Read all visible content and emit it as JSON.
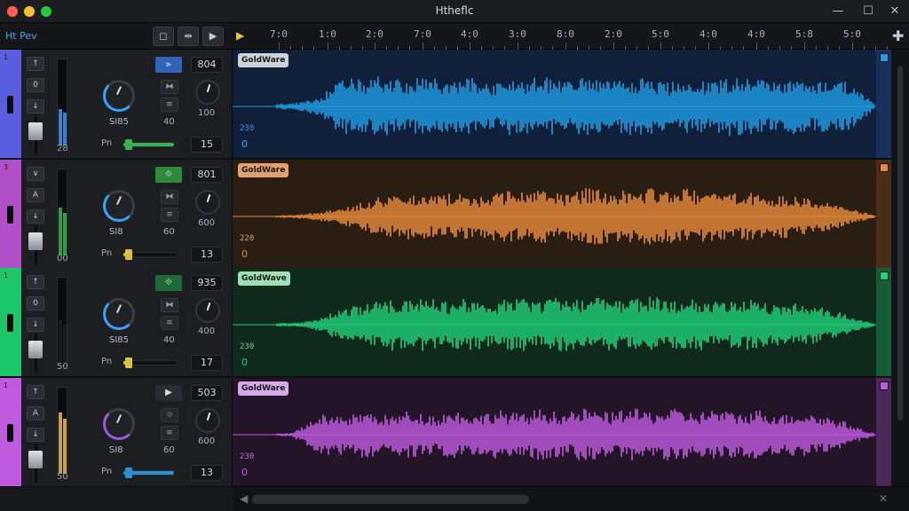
{
  "window": {
    "title": "Htheflc",
    "controls": {
      "minimize": "—",
      "maximize": "☐",
      "close": "✕"
    }
  },
  "toolbar": {
    "project_label": "Ht Pev",
    "buttons": [
      {
        "name": "loop-button",
        "glyph": "◻"
      },
      {
        "name": "snap-button",
        "glyph": "⇹"
      },
      {
        "name": "play-button",
        "glyph": "▶"
      }
    ],
    "add_track": "✚"
  },
  "ruler": {
    "labels": [
      "7:0",
      "1:0",
      "2:0",
      "7:0",
      "4:0",
      "3:0",
      "8:0",
      "2:0",
      "5:0",
      "4:0",
      "4:0",
      "5:8",
      "5:0"
    ]
  },
  "tracks": [
    {
      "color": "#1e9ee6",
      "strip_color": "#5a5fe0",
      "label_color": "#cfd2d8",
      "strip_num": "1",
      "side_buttons": [
        "↑",
        "0",
        "↓"
      ],
      "mode_glyph": "⫸",
      "mode_bg": "#2f64b8",
      "knob_label": "SI85",
      "knob_arc": "#3aa0ff",
      "icon_buttons": [
        "⧓",
        "≡"
      ],
      "icon_value": "40",
      "value": "804",
      "small_knob_value": "100",
      "meter_value": "28",
      "meter_level": 0.42,
      "meter_color": "#3a7fd0",
      "pan_label": "Pn",
      "pan_value": "15",
      "pan_level": 0.95,
      "pan_color": "#37b24d",
      "clip_label": "GoldWare",
      "lane_num_a": "230",
      "lane_num_b": "0",
      "lane_bg": "#11203a",
      "lane_a_color": "#3a93e0",
      "lane_b_color": "#3aa0ff",
      "endcap_bg": "#17315a",
      "envelope": [
        0.08,
        0.1,
        0.16,
        0.3,
        0.7,
        0.85,
        0.78,
        0.92,
        0.84,
        0.74,
        0.9,
        0.82,
        0.72,
        0.88,
        0.8,
        0.7,
        0.86,
        0.78,
        0.92,
        0.84,
        0.76,
        0.9,
        0.82,
        0.72,
        0.88,
        0.86,
        0.8,
        0.7,
        0.86,
        0.8,
        0.74,
        0.88,
        0.9,
        0.84,
        0.74,
        0.86,
        0.8,
        0.72,
        0.84,
        0.78,
        0.5,
        0.1
      ]
    },
    {
      "color": "#e88a3a",
      "strip_color": "#b04fc6",
      "label_color": "#e0a070",
      "strip_num": "3",
      "side_buttons": [
        "∨",
        "A",
        "↓"
      ],
      "mode_glyph": "⟐",
      "mode_bg": "#2d8a3a",
      "knob_label": "SI8",
      "knob_arc": "#3aa0ff",
      "icon_buttons": [
        "⧓",
        "≡"
      ],
      "icon_value": "60",
      "value": "801",
      "small_knob_value": "600",
      "meter_value": "00",
      "meter_level": 0.55,
      "meter_color": "#2ea043",
      "pan_label": "Pn",
      "pan_value": "13",
      "pan_level": 0.12,
      "pan_color": "#d9c13a",
      "clip_label": "GoldWare",
      "lane_num_a": "220",
      "lane_num_b": "0",
      "lane_bg": "#2a1d12",
      "lane_a_color": "#e0a070",
      "lane_b_color": "#e88a3a",
      "endcap_bg": "#4a2e18",
      "envelope": [
        0.04,
        0.05,
        0.08,
        0.14,
        0.22,
        0.3,
        0.44,
        0.58,
        0.62,
        0.7,
        0.66,
        0.6,
        0.72,
        0.68,
        0.62,
        0.74,
        0.76,
        0.72,
        0.8,
        0.76,
        0.7,
        0.84,
        0.86,
        0.8,
        0.78,
        0.86,
        0.88,
        0.82,
        0.84,
        0.76,
        0.8,
        0.72,
        0.74,
        0.7,
        0.64,
        0.66,
        0.56,
        0.5,
        0.42,
        0.3,
        0.16,
        0.06
      ]
    },
    {
      "color": "#1fd17a",
      "strip_color": "#1ec86a",
      "label_color": "#9ee0b4",
      "strip_num": "1",
      "side_buttons": [
        "↑",
        "0",
        "↓"
      ],
      "mode_glyph": "⟐",
      "mode_bg": "#1f6a36",
      "knob_label": "SI85",
      "knob_arc": "#3aa0ff",
      "icon_buttons": [
        "⧓",
        "≡"
      ],
      "icon_value": "40",
      "value": "935",
      "small_knob_value": "400",
      "meter_value": "50",
      "meter_level": 0.5,
      "meter_color": "#1a1b1e",
      "pan_label": "Pn",
      "pan_value": "17",
      "pan_level": 0.14,
      "pan_color": "#d9c13a",
      "clip_label": "GoldWave",
      "lane_num_a": "230",
      "lane_num_b": "0",
      "lane_bg": "#0f2a1c",
      "lane_a_color": "#6bd79b",
      "lane_b_color": "#1fd17a",
      "endcap_bg": "#165c36",
      "envelope": [
        0.05,
        0.06,
        0.1,
        0.22,
        0.4,
        0.56,
        0.62,
        0.72,
        0.78,
        0.7,
        0.82,
        0.74,
        0.68,
        0.8,
        0.76,
        0.66,
        0.84,
        0.78,
        0.7,
        0.86,
        0.8,
        0.72,
        0.82,
        0.76,
        0.7,
        0.8,
        0.84,
        0.78,
        0.72,
        0.8,
        0.74,
        0.68,
        0.76,
        0.72,
        0.66,
        0.7,
        0.62,
        0.56,
        0.46,
        0.32,
        0.16,
        0.06
      ]
    },
    {
      "color": "#c05be0",
      "strip_color": "#c05be0",
      "label_color": "#d6a9ea",
      "strip_num": "1",
      "side_buttons": [
        "↑",
        "A",
        "↓"
      ],
      "mode_glyph": "▶",
      "mode_bg": "#2b2d32",
      "knob_label": "SI8",
      "knob_arc": "#9b59e0",
      "icon_buttons": [
        "⟐",
        "≡"
      ],
      "icon_value": "60",
      "value": "503",
      "small_knob_value": "600",
      "meter_value": "50",
      "meter_level": 0.7,
      "meter_color": "#c8a23a",
      "pan_label": "Pn",
      "pan_value": "13",
      "pan_level": 0.95,
      "pan_color": "#2b8fd6",
      "clip_label": "GoldWare",
      "lane_num_a": "230",
      "lane_num_b": "0",
      "lane_bg": "#231428",
      "lane_a_color": "#b07ac6",
      "lane_b_color": "#c05be0",
      "endcap_bg": "#4b2a5a",
      "envelope": [
        0.04,
        0.06,
        0.3,
        0.6,
        0.64,
        0.58,
        0.7,
        0.62,
        0.56,
        0.72,
        0.64,
        0.58,
        0.74,
        0.66,
        0.6,
        0.76,
        0.68,
        0.62,
        0.78,
        0.7,
        0.64,
        0.8,
        0.72,
        0.66,
        0.82,
        0.74,
        0.68,
        0.8,
        0.72,
        0.66,
        0.78,
        0.7,
        0.64,
        0.76,
        0.68,
        0.6,
        0.7,
        0.62,
        0.54,
        0.4,
        0.2,
        0.06
      ]
    }
  ]
}
